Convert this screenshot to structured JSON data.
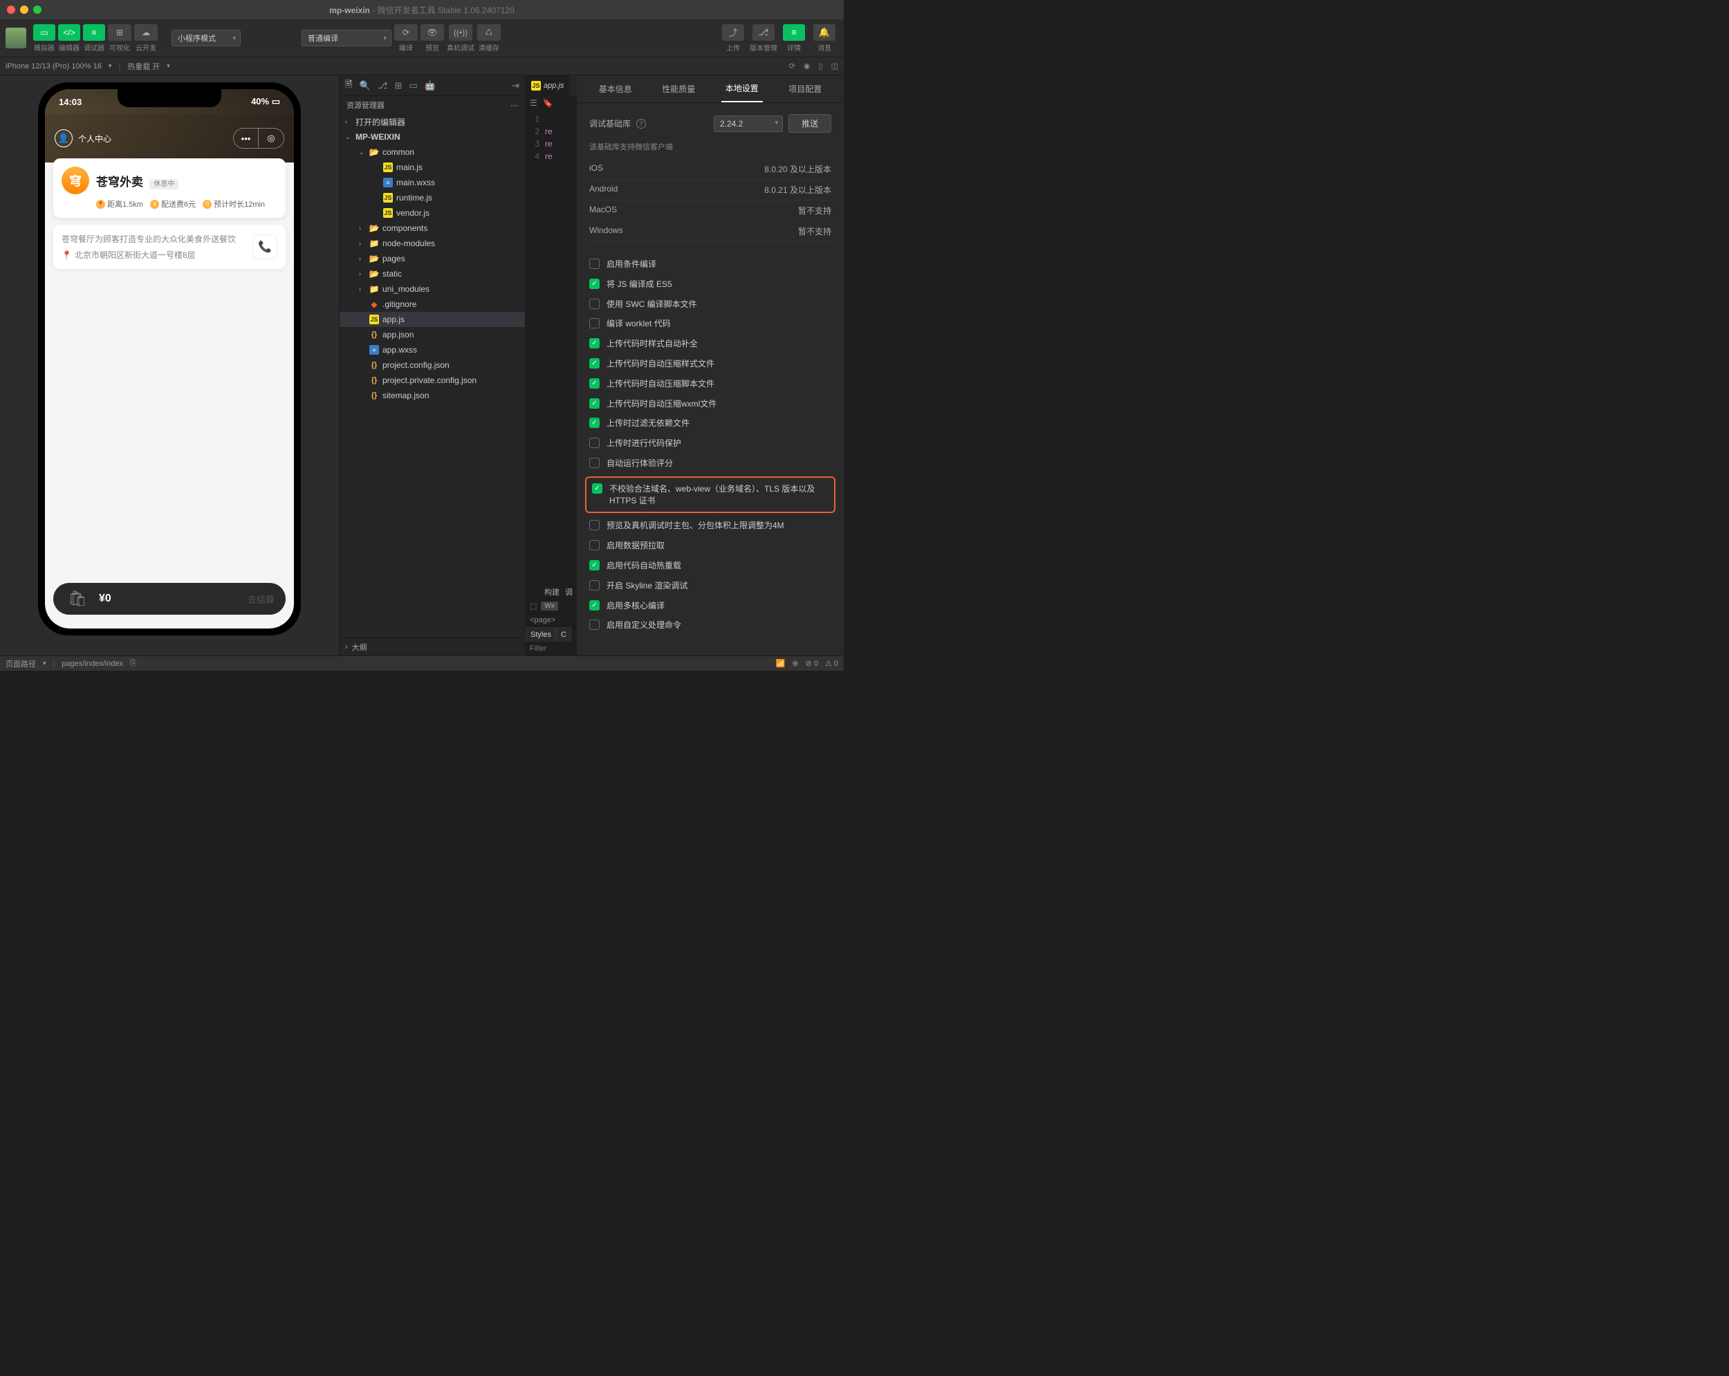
{
  "titlebar": {
    "project": "mp-weixin",
    "app": "微信开发者工具 Stable 1.06.2407120"
  },
  "toolbar": {
    "sim_labels": [
      "模拟器",
      "编辑器",
      "调试器"
    ],
    "visualize": "可视化",
    "cloud": "云开发",
    "mode_select": "小程序模式",
    "compile_select": "普通编译",
    "actions": {
      "compile": "编译",
      "preview": "预览",
      "remote": "真机调试",
      "clear": "清缓存"
    },
    "right": {
      "upload": "上传",
      "version": "版本管理",
      "details": "详情",
      "message": "消息"
    }
  },
  "subbar": {
    "device": "iPhone 12/13 (Pro) 100% 16",
    "hotreload": "热重载 开"
  },
  "phone": {
    "time": "14:03",
    "battery": "40%",
    "hero_title": "个人中心",
    "shop_name": "苍穹外卖",
    "rest_badge": "休息中",
    "chips": {
      "distance": "距离1.5km",
      "fee": "配送费6元",
      "eta": "预计时长12min"
    },
    "desc": "苍穹餐厅为顾客打造专业的大众化美食外送餐饮",
    "address": "北京市朝阳区新街大道一号楼8层",
    "cart_price": "¥0",
    "cart_go": "去结算"
  },
  "explorer": {
    "title": "资源管理器",
    "open_editors": "打开的编辑器",
    "root": "MP-WEIXIN",
    "outline": "大纲",
    "tree": [
      {
        "type": "folder-g",
        "name": "common",
        "indent": 28,
        "open": true
      },
      {
        "type": "js",
        "name": "main.js",
        "indent": 48
      },
      {
        "type": "wxss",
        "name": "main.wxss",
        "indent": 48
      },
      {
        "type": "js",
        "name": "runtime.js",
        "indent": 48
      },
      {
        "type": "js",
        "name": "vendor.js",
        "indent": 48
      },
      {
        "type": "folder-g",
        "name": "components",
        "indent": 28,
        "chev": "›"
      },
      {
        "type": "folder",
        "name": "node-modules",
        "indent": 28,
        "chev": "›"
      },
      {
        "type": "folder-g",
        "name": "pages",
        "indent": 28,
        "chev": "›"
      },
      {
        "type": "folder-g",
        "name": "static",
        "indent": 28,
        "chev": "›"
      },
      {
        "type": "folder",
        "name": "uni_modules",
        "indent": 28,
        "chev": "›"
      },
      {
        "type": "git",
        "name": ".gitignore",
        "indent": 28
      },
      {
        "type": "js",
        "name": "app.js",
        "indent": 28,
        "selected": true
      },
      {
        "type": "json",
        "name": "app.json",
        "indent": 28
      },
      {
        "type": "wxss",
        "name": "app.wxss",
        "indent": 28
      },
      {
        "type": "json",
        "name": "project.config.json",
        "indent": 28
      },
      {
        "type": "json",
        "name": "project.private.config.json",
        "indent": 28
      },
      {
        "type": "json",
        "name": "sitemap.json",
        "indent": 28
      }
    ]
  },
  "editor": {
    "tab": "app.js",
    "lines": [
      "",
      "re",
      "re",
      "re"
    ]
  },
  "devtools": {
    "build": "构建",
    "debugger": "调",
    "wxml_badge": "Wx",
    "page_tag": "<page>",
    "styles": "Styles",
    "c": "C",
    "filter": "Filter"
  },
  "panel": {
    "tabs": [
      "基本信息",
      "性能质量",
      "本地设置",
      "项目配置"
    ],
    "active_tab": 2,
    "baselib_label": "调试基础库",
    "baselib_version": "2.24.2",
    "push": "推送",
    "support_caption": "该基础库支持微信客户端",
    "support": [
      {
        "os": "iOS",
        "ver": "8.0.20 及以上版本"
      },
      {
        "os": "Android",
        "ver": "8.0.21 及以上版本"
      },
      {
        "os": "MacOS",
        "ver": "暂不支持"
      },
      {
        "os": "Windows",
        "ver": "暂不支持"
      }
    ],
    "checks": [
      {
        "on": false,
        "label": "启用条件编译"
      },
      {
        "on": true,
        "label": "将 JS 编译成 ES5"
      },
      {
        "on": false,
        "label": "使用 SWC 编译脚本文件"
      },
      {
        "on": false,
        "label": "编译 worklet 代码"
      },
      {
        "on": true,
        "label": "上传代码时样式自动补全"
      },
      {
        "on": true,
        "label": "上传代码时自动压缩样式文件"
      },
      {
        "on": true,
        "label": "上传代码时自动压缩脚本文件"
      },
      {
        "on": true,
        "label": "上传代码时自动压缩wxml文件"
      },
      {
        "on": true,
        "label": "上传时过滤无依赖文件"
      },
      {
        "on": false,
        "label": "上传时进行代码保护"
      },
      {
        "on": false,
        "label": "自动运行体验评分"
      },
      {
        "on": true,
        "label": "不校验合法域名、web-view（业务域名）、TLS 版本以及 HTTPS 证书",
        "hl": true
      },
      {
        "on": false,
        "label": "预览及真机调试时主包、分包体积上限调整为4M"
      },
      {
        "on": false,
        "label": "启用数据预拉取"
      },
      {
        "on": true,
        "label": "启用代码自动热重载"
      },
      {
        "on": false,
        "label": "开启 Skyline 渲染调试"
      },
      {
        "on": true,
        "label": "启用多核心编译"
      },
      {
        "on": false,
        "label": "启用自定义处理命令"
      }
    ]
  },
  "footer": {
    "page_path_label": "页面路径",
    "page_path": "pages/index/index",
    "errors": "0",
    "warnings": "0"
  }
}
